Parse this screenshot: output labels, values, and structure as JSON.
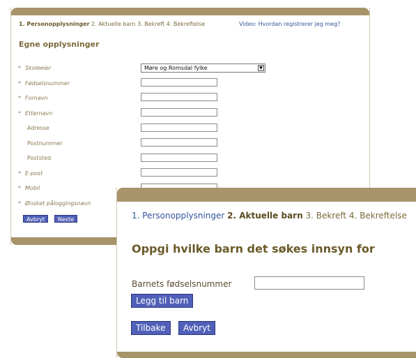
{
  "form1": {
    "steps": {
      "step1": "1. Personopplysninger",
      "rest": " 2. Aktuelle barn 3. Bekreft 4. Bekreftelse"
    },
    "video_link": "Video: Hvordan registrerer jeg meg?",
    "heading": "Egne opplysninger",
    "required_marker": "*",
    "fields": {
      "skoleeier": {
        "label": "Skoleeier",
        "value": "Møre og Romsdal fylke"
      },
      "fodselsnummer": {
        "label": "Fødselsnummer"
      },
      "fornavn": {
        "label": "Fornavn"
      },
      "etternavn": {
        "label": "Etternavn"
      },
      "adresse": {
        "label": "Adresse"
      },
      "postnummer": {
        "label": "Postnummer"
      },
      "poststed": {
        "label": "Poststed"
      },
      "epost": {
        "label": "E-post"
      },
      "mobil": {
        "label": "Mobil"
      },
      "brukernavn": {
        "label": "Ønsket påloggingsnavn"
      }
    },
    "buttons": {
      "cancel": "Avbryt",
      "next": "Neste"
    }
  },
  "form2": {
    "steps": {
      "step1": "1. Personopplysninger",
      "step2": "2. Aktuelle barn",
      "rest": " 3. Bekreft 4. Bekreftelse"
    },
    "heading": "Oppgi hvilke barn det søkes innsyn for",
    "child_id_label": "Barnets fødselsnummer",
    "buttons": {
      "add_child": "Legg til barn",
      "back": "Tilbake",
      "cancel": "Avbryt"
    }
  },
  "colors": {
    "accent": "#a8946b",
    "button": "#5060b8",
    "heading": "#6b5a28",
    "link": "#33559a"
  }
}
